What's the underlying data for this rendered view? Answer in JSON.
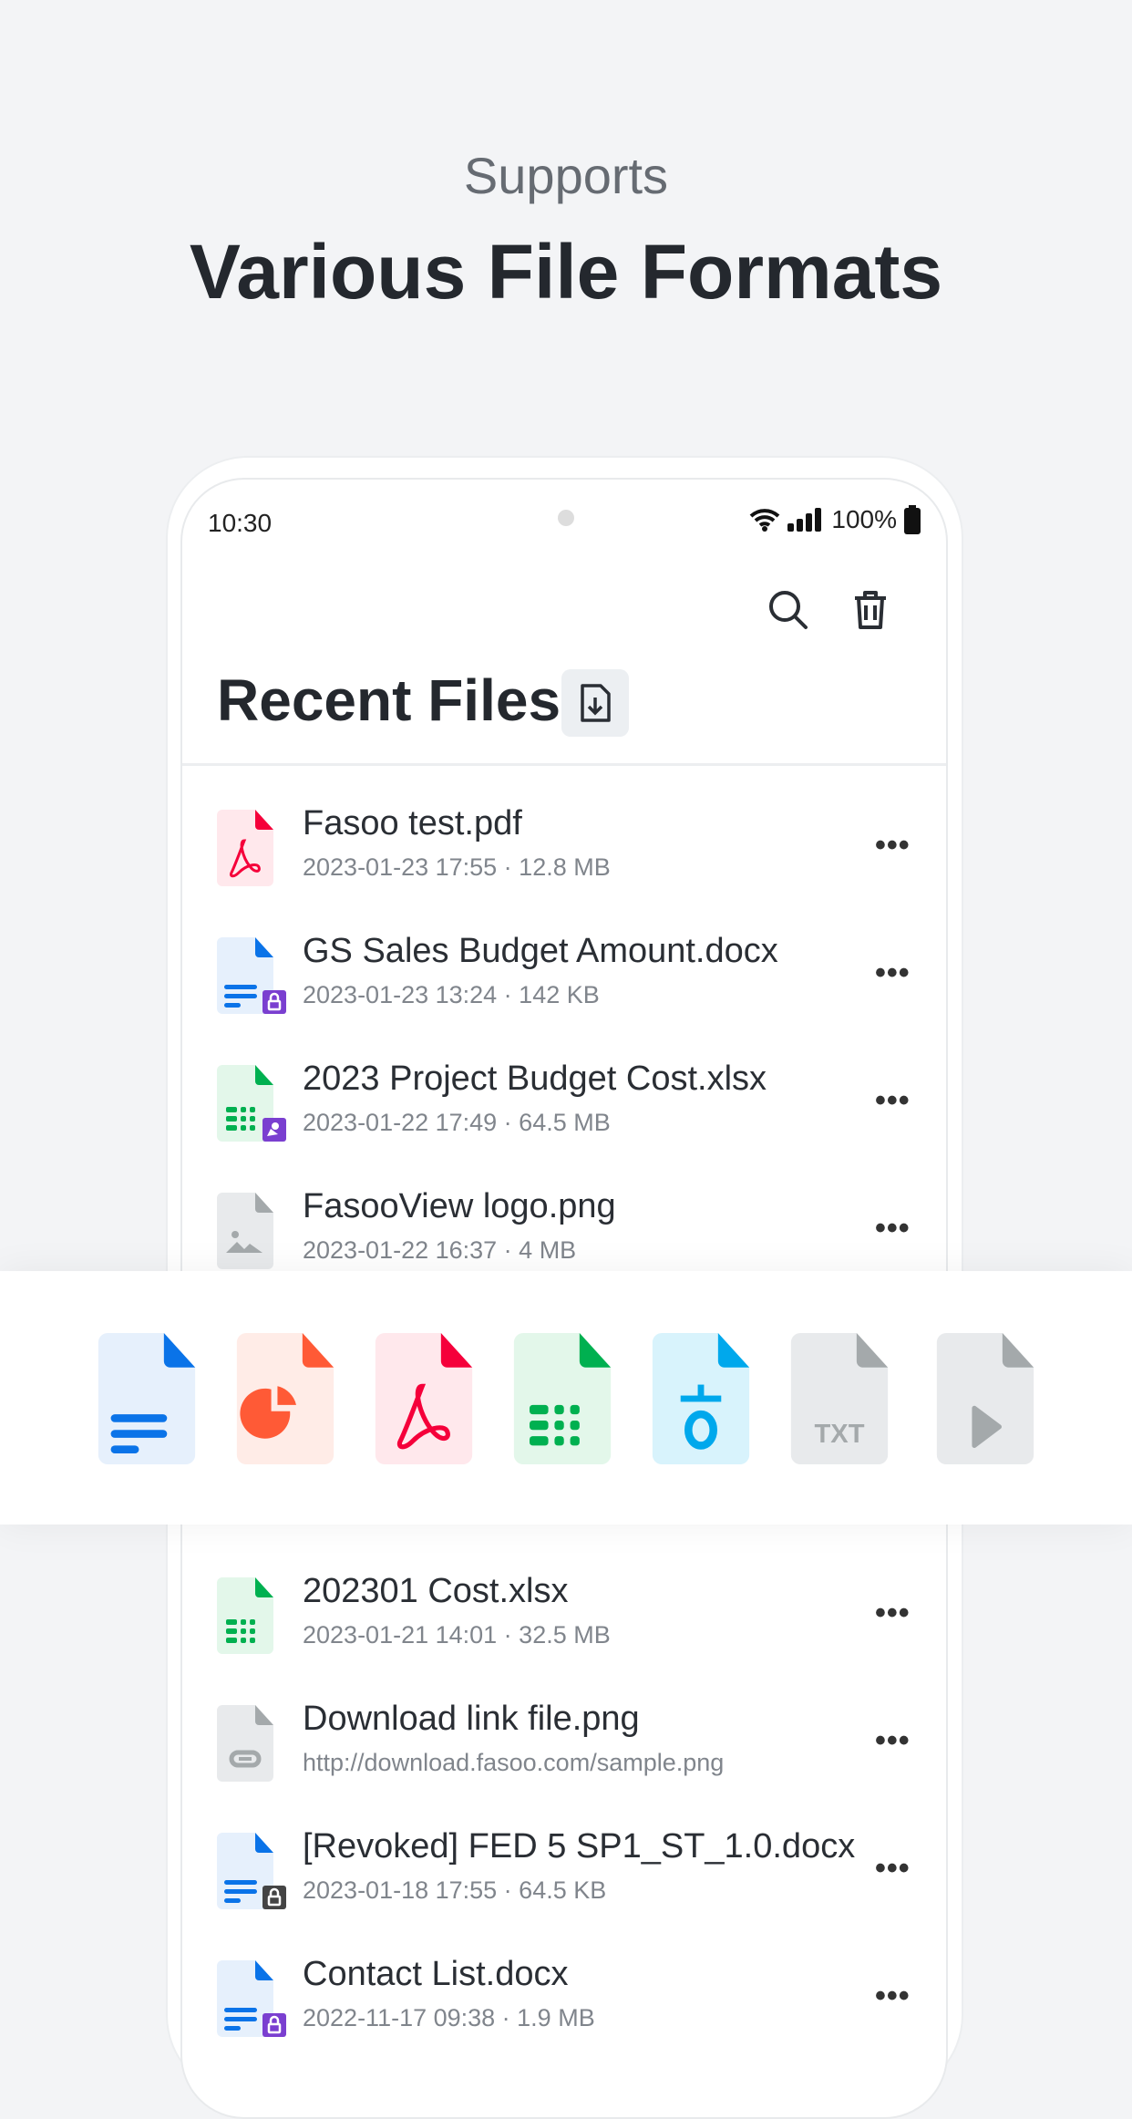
{
  "headline": {
    "sub": "Supports",
    "main": "Various File Formats"
  },
  "status_bar": {
    "time": "10:30",
    "battery": "100%",
    "icons": [
      "wifi-icon",
      "signal-icon",
      "battery-icon"
    ]
  },
  "toolbar": {
    "icons": [
      "search-icon",
      "trash-icon"
    ]
  },
  "page": {
    "title": "Recent Files",
    "title_button_icon": "file-download-icon"
  },
  "files_top": [
    {
      "name": "Fasoo test.pdf",
      "meta": "2023-01-23  17:55 · 12.8 MB",
      "type": "pdf",
      "badge": ""
    },
    {
      "name": "GS Sales Budget Amount.docx",
      "meta": "2023-01-23  13:24 · 142 KB",
      "type": "doc",
      "badge": "lock-purple"
    },
    {
      "name": "2023 Project Budget Cost.xlsx",
      "meta": "2023-01-22  17:49 · 64.5 MB",
      "type": "xls",
      "badge": "satellite-purple"
    },
    {
      "name": "FasooView logo.png",
      "meta": "2023-01-22  16:37 · 4 MB",
      "type": "img",
      "badge": ""
    }
  ],
  "files_bottom": [
    {
      "name": "202301 Cost.xlsx",
      "meta": "2023-01-21  14:01 · 32.5 MB",
      "type": "xls",
      "badge": ""
    },
    {
      "name": "Download link file.png",
      "meta": "http://download.fasoo.com/sample.png",
      "type": "link",
      "badge": ""
    },
    {
      "name": "[Revoked] FED 5 SP1_ST_1.0.docx",
      "meta": "2023-01-18  17:55 · 64.5 KB",
      "type": "doc",
      "badge": "lock-dark"
    },
    {
      "name": "Contact List.docx",
      "meta": "2022-11-17  09:38 · 1.9 MB",
      "type": "doc",
      "badge": "lock-purple"
    }
  ],
  "more_label": "•••",
  "formats": [
    {
      "type": "doc",
      "label": ""
    },
    {
      "type": "ppt",
      "label": ""
    },
    {
      "type": "pdf",
      "label": ""
    },
    {
      "type": "xls",
      "label": ""
    },
    {
      "type": "hwp",
      "label": ""
    },
    {
      "type": "txt",
      "label": "TXT"
    },
    {
      "type": "video",
      "label": ""
    }
  ],
  "colors": {
    "doc": "#0a73e8",
    "ppt": "#ff5a36",
    "pdf": "#f5003a",
    "xls": "#00b050",
    "hwp": "#00a8ec",
    "gray": "#a4a9ab",
    "purple": "#7a3fd0"
  }
}
